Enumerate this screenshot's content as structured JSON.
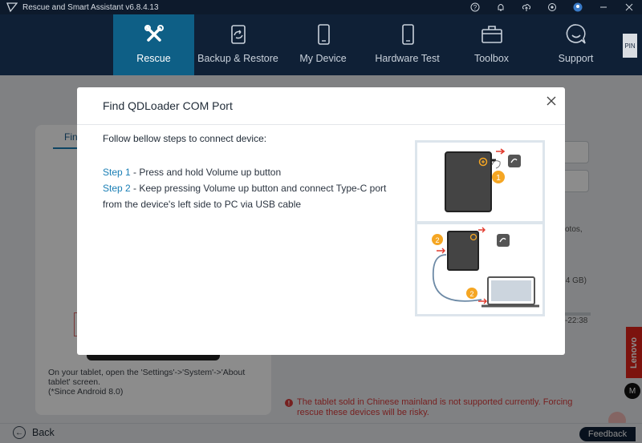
{
  "window": {
    "title": "Rescue and Smart Assistant v6.8.4.13"
  },
  "nav": {
    "items": [
      {
        "label": "Rescue",
        "icon": "tools-icon"
      },
      {
        "label": "Backup & Restore",
        "icon": "backup-icon"
      },
      {
        "label": "My Device",
        "icon": "phone-icon"
      },
      {
        "label": "Hardware Test",
        "icon": "phone-test-icon"
      },
      {
        "label": "Toolbox",
        "icon": "toolbox-icon"
      },
      {
        "label": "Support",
        "icon": "support-icon"
      }
    ],
    "pin_label": "PIN"
  },
  "background": {
    "tab_label": "Fin",
    "instructions": "On your tablet, open the 'Settings'->'System'->'About tablet' screen.\n(*Since Android 8.0)",
    "side_text_1": "otos,",
    "side_text_2": ".4 GB)",
    "side_text_3": "-22:38",
    "warning": "The tablet sold in Chinese mainland is not supported currently. Forcing rescue these devices will be risky.",
    "brand_label": "Lenovo",
    "moto_label": "M",
    "back_label": "Back",
    "feedback_label": "Feedback"
  },
  "modal": {
    "title": "Find QDLoader COM Port",
    "intro": "Follow bellow steps to connect device:",
    "steps": [
      {
        "label": "Step 1",
        "text": " - Press and hold Volume up button"
      },
      {
        "label": "Step 2",
        "text": " - Keep pressing Volume up button and connect Type-C port from the device's left side to PC via USB cable"
      }
    ],
    "illustration": {
      "badge_1": "1",
      "badge_2": "2",
      "badge_3": "2"
    }
  },
  "colors": {
    "accent": "#1a7fb5",
    "nav_bg": "#0f2036",
    "active_nav": "#0e5f86",
    "warning": "#d83b3b",
    "badge": "#f5a623"
  }
}
